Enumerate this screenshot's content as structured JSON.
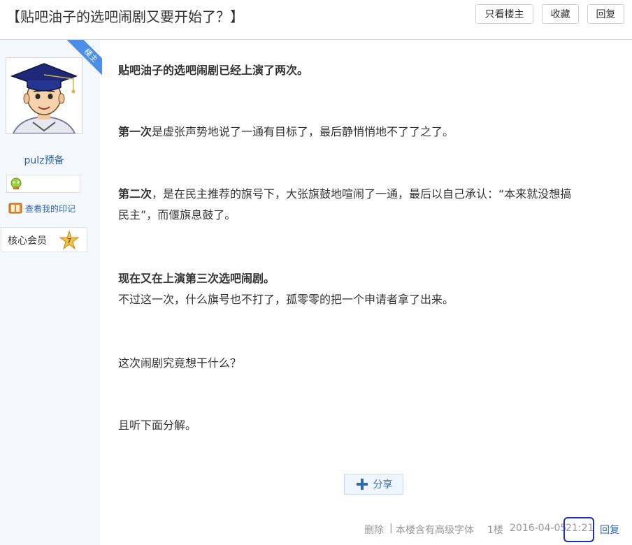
{
  "header": {
    "title": "【贴吧油子的选吧闹剧又要开始了？】",
    "buttons": {
      "only_op": "只看楼主",
      "favorite": "收藏",
      "reply": "回复"
    }
  },
  "author": {
    "ribbon": "楼主",
    "username": "pulz预备",
    "imprint_link": "查看我的印记",
    "member_label": "核心会员",
    "level": "7"
  },
  "post": {
    "p1": "贴吧油子的选吧闹剧已经上演了两次。",
    "p2_bold": "第一次",
    "p2_rest": "是虚张声势地说了一通有目标了，最后静悄悄地不了了之了。",
    "p3_bold": "第二次",
    "p3_rest": "，是在民主推荐的旗号下，大张旗鼓地喧闹了一通，最后以自己承认：“本来就没想搞",
    "p3_line2": "民主”，而偃旗息鼓了。",
    "p4_bold": "现在又在上演第三次选吧闹剧。",
    "p4_line2": "不过这一次，什么旗号也不打了，孤零零的把一个申请者拿了出来。",
    "p5": "这次闹剧究竟想干什么？",
    "p6": "且听下面分解。"
  },
  "share": {
    "label": "分享"
  },
  "footer": {
    "delete": "删除",
    "separator": "|",
    "advanced_font": "本楼含有高级字体",
    "floor": "1楼",
    "date": "2016-04-05",
    "time": "21:21",
    "reply": "回复"
  },
  "colors": {
    "link": "#2d64b3",
    "ribbon": "#4b8ee8",
    "annotation": "#1e2fbf"
  }
}
